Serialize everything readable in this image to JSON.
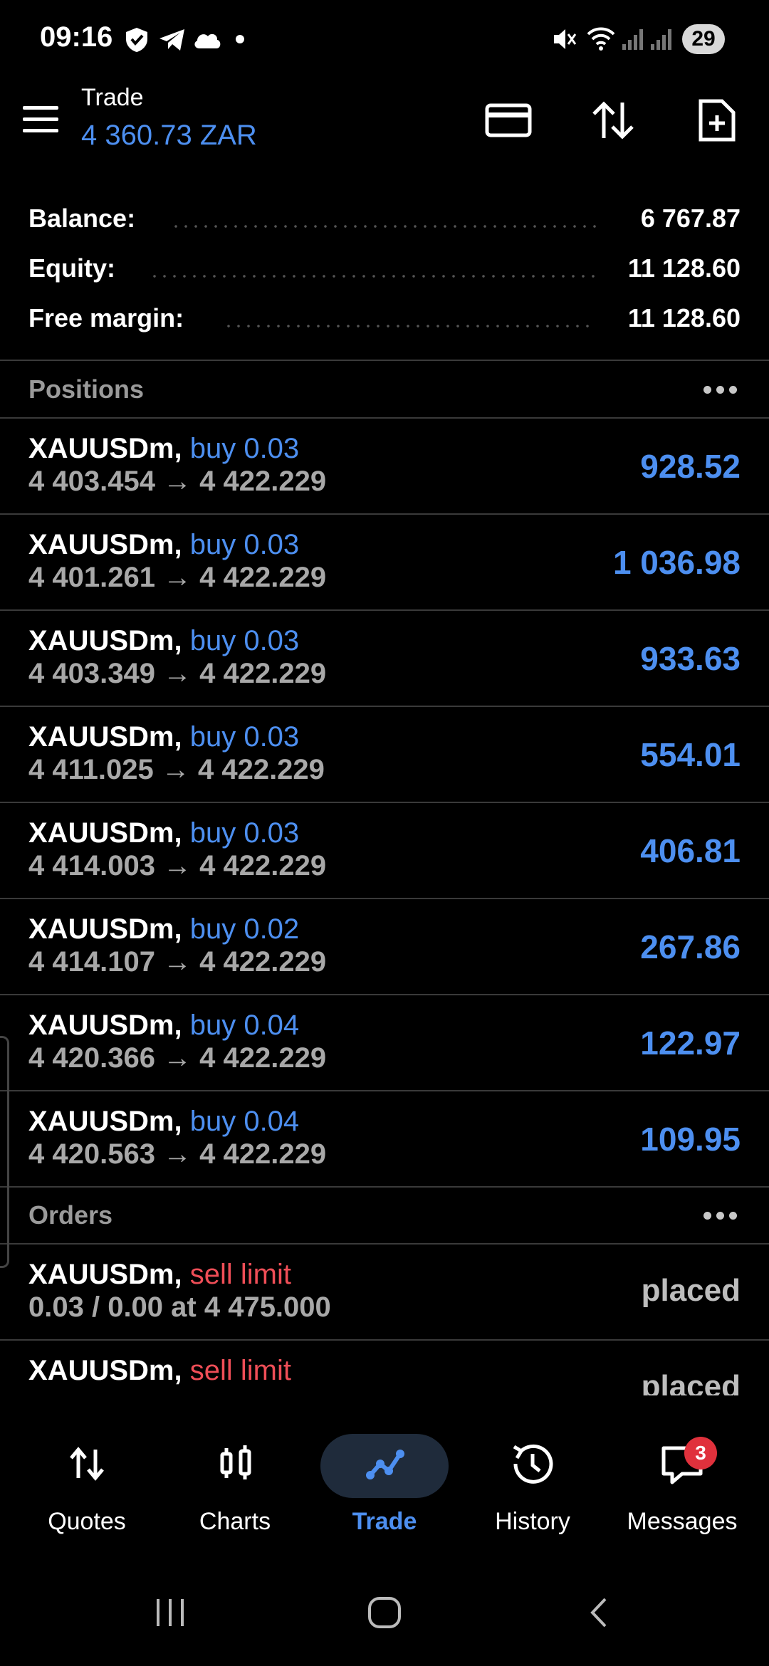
{
  "status_bar": {
    "time": "09:16",
    "battery": "29",
    "icons": [
      "vpn-shield-icon",
      "telegram-icon",
      "cloud-icon",
      "dot-icon",
      "mute-icon",
      "wifi-icon",
      "signal-icon",
      "signal-icon"
    ]
  },
  "app_bar": {
    "title": "Trade",
    "subtitle": "4 360.73 ZAR",
    "icons": [
      "menu-icon",
      "card-icon",
      "sort-icon",
      "new-order-icon"
    ]
  },
  "summary": {
    "balance_label": "Balance:",
    "balance_value": "6 767.87",
    "equity_label": "Equity:",
    "equity_value": "11 128.60",
    "free_margin_label": "Free margin:",
    "free_margin_value": "11 128.60"
  },
  "positions": {
    "header": "Positions",
    "items": [
      {
        "symbol": "XAUUSDm,",
        "side": "buy 0.03",
        "prices": "4 403.454 → 4 422.229",
        "profit": "928.52"
      },
      {
        "symbol": "XAUUSDm,",
        "side": "buy 0.03",
        "prices": "4 401.261 → 4 422.229",
        "profit": "1 036.98"
      },
      {
        "symbol": "XAUUSDm,",
        "side": "buy 0.03",
        "prices": "4 403.349 → 4 422.229",
        "profit": "933.63"
      },
      {
        "symbol": "XAUUSDm,",
        "side": "buy 0.03",
        "prices": "4 411.025 → 4 422.229",
        "profit": "554.01"
      },
      {
        "symbol": "XAUUSDm,",
        "side": "buy 0.03",
        "prices": "4 414.003 → 4 422.229",
        "profit": "406.81"
      },
      {
        "symbol": "XAUUSDm,",
        "side": "buy 0.02",
        "prices": "4 414.107 → 4 422.229",
        "profit": "267.86"
      },
      {
        "symbol": "XAUUSDm,",
        "side": "buy 0.04",
        "prices": "4 420.366 → 4 422.229",
        "profit": "122.97"
      },
      {
        "symbol": "XAUUSDm,",
        "side": "buy 0.04",
        "prices": "4 420.563 → 4 422.229",
        "profit": "109.95"
      }
    ]
  },
  "orders": {
    "header": "Orders",
    "items": [
      {
        "symbol": "XAUUSDm,",
        "side": "sell limit",
        "details": "0.03 / 0.00 at 4 475.000",
        "status": "placed"
      },
      {
        "symbol": "XAUUSDm,",
        "side": "sell limit",
        "details": "",
        "status": "placed"
      }
    ]
  },
  "bottom_nav": {
    "items": [
      {
        "label": "Quotes",
        "icon": "quotes-icon"
      },
      {
        "label": "Charts",
        "icon": "charts-icon"
      },
      {
        "label": "Trade",
        "icon": "trade-icon",
        "active": true
      },
      {
        "label": "History",
        "icon": "history-icon"
      },
      {
        "label": "Messages",
        "icon": "messages-icon"
      }
    ],
    "messages_badge": "3"
  },
  "colors": {
    "accent_blue": "#4d8ff0",
    "sell_red": "#ef4e57",
    "muted_gray": "#a8a8a8"
  }
}
